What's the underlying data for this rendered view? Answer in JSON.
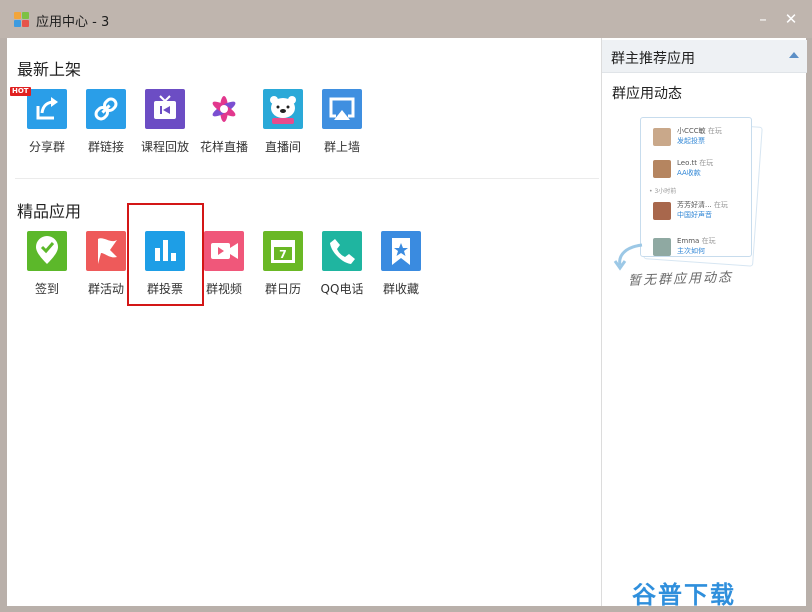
{
  "window": {
    "title": "应用中心 - 3",
    "minimize_glyph": "–",
    "close_glyph": "✕"
  },
  "main": {
    "section_new": {
      "title": "最新上架",
      "apps": [
        {
          "label": "分享群",
          "icon": "share-icon",
          "color": "#2a9ee8",
          "badge": "HOT"
        },
        {
          "label": "群链接",
          "icon": "link-icon",
          "color": "#2a9ee8"
        },
        {
          "label": "课程回放",
          "icon": "tv-replay-icon",
          "color": "#6c4dc4"
        },
        {
          "label": "花样直播",
          "icon": "flower-star-icon",
          "color": "#ffffff"
        },
        {
          "label": "直播间",
          "icon": "bear-icon",
          "color": "#2aa9d8"
        },
        {
          "label": "群上墙",
          "icon": "airplay-icon",
          "color": "#3f8fe0"
        }
      ]
    },
    "section_featured": {
      "title": "精品应用",
      "apps": [
        {
          "label": "签到",
          "icon": "checkin-pin-icon",
          "color": "#5cb82a"
        },
        {
          "label": "群活动",
          "icon": "flag-icon",
          "color": "#ee5a5a"
        },
        {
          "label": "群投票",
          "icon": "bar-chart-icon",
          "color": "#1e9ee6"
        },
        {
          "label": "群视频",
          "icon": "video-camera-icon",
          "color": "#f0577a"
        },
        {
          "label": "群日历",
          "icon": "calendar-icon",
          "color": "#6ab825"
        },
        {
          "label": "QQ电话",
          "icon": "phone-icon",
          "color": "#1fb5a0"
        },
        {
          "label": "群收藏",
          "icon": "bookmark-star-icon",
          "color": "#3a8be0"
        }
      ]
    }
  },
  "sidebar": {
    "header": "群主推荐应用",
    "subtitle": "群应用动态",
    "feed": [
      {
        "name": "小CCC敏",
        "status": "在玩",
        "action": "发起投票"
      },
      {
        "name": "Leo.tt",
        "status": "在玩",
        "action": "AA收款"
      },
      {
        "time": "• 3小时前"
      },
      {
        "name": "芳芳好清...",
        "status": "在玩",
        "action": "中国好声音"
      },
      {
        "name": "Emma",
        "status": "在玩",
        "action": "主次如何"
      }
    ],
    "empty_text": "暂无群应用动态"
  },
  "watermark": "谷普下载"
}
